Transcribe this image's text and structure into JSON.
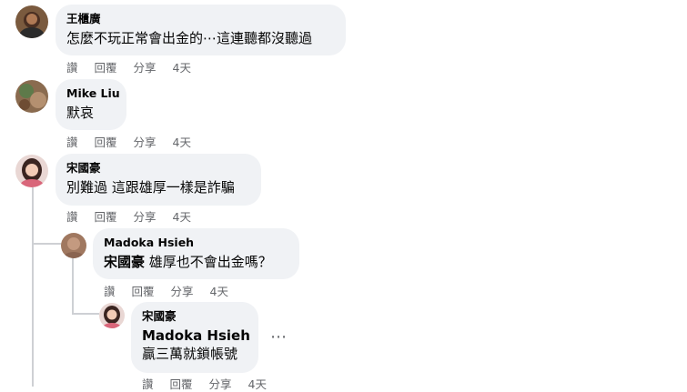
{
  "comments": [
    {
      "author": "王櫃廣",
      "text": "怎麼不玩正常會出金的⋯這連聽都沒聽過",
      "actions": {
        "like": "讚",
        "reply": "回覆",
        "share": "分享",
        "time": "4天"
      },
      "avatar": "avatar-dark-portrait"
    },
    {
      "author": "Mike Liu",
      "text": "默哀",
      "actions": {
        "like": "讚",
        "reply": "回覆",
        "share": "分享",
        "time": "4天"
      },
      "avatar": "avatar-nature-photo"
    },
    {
      "author": "宋國豪",
      "text": "別難過 這跟雄厚一樣是詐騙",
      "actions": {
        "like": "讚",
        "reply": "回覆",
        "share": "分享",
        "time": "4天"
      },
      "avatar": "avatar-woman-portrait"
    }
  ],
  "replies": [
    {
      "author": "Madoka Hsieh",
      "mention": "宋國豪",
      "text": "雄厚也不會出金嗎？",
      "actions": {
        "like": "讚",
        "reply": "回覆",
        "share": "分享",
        "time": "4天"
      },
      "avatar": "avatar-brown-portrait"
    },
    {
      "author": "宋國豪",
      "mention": "Madoka Hsieh",
      "text": "贏三萬就鎖帳號",
      "actions": {
        "like": "讚",
        "reply": "回覆",
        "share": "分享",
        "time": "4天"
      },
      "avatar": "avatar-woman-portrait",
      "more_icon": "more-horizontal-icon"
    }
  ],
  "colors": {
    "bubble": "#f0f2f5",
    "meta_text": "#65676b",
    "thread_line": "#ced0d4"
  }
}
